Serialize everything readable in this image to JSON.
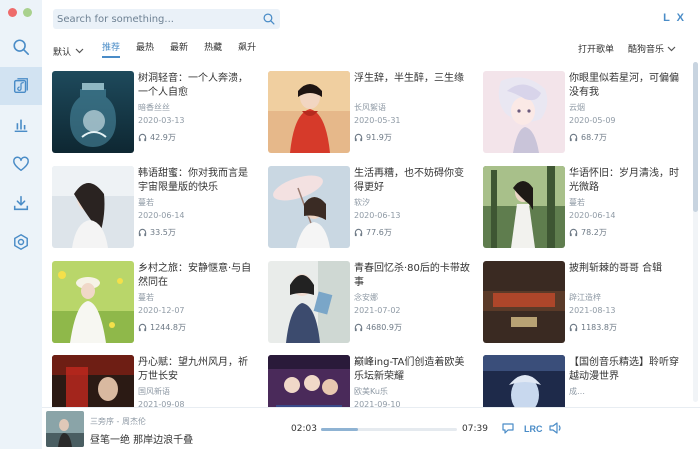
{
  "header": {
    "search_placeholder": "Search for something...",
    "brand": "L X"
  },
  "tabs": {
    "sort_label": "默认",
    "items": [
      "推荐",
      "最热",
      "最新",
      "热藏",
      "飙升"
    ],
    "active_index": 0,
    "open_list": "打开歌单",
    "source": "酷狗音乐"
  },
  "colors": {
    "accent": "#4a8cc7",
    "sidebar_bg": "#ecf3f9",
    "sidebar_active": "#d2e3f2"
  },
  "sidebar": {
    "items": [
      {
        "icon": "search-icon"
      },
      {
        "icon": "music-list-icon",
        "active": true
      },
      {
        "icon": "chart-icon"
      },
      {
        "icon": "heart-icon"
      },
      {
        "icon": "download-icon"
      },
      {
        "icon": "settings-icon"
      }
    ]
  },
  "playlists": [
    {
      "title": "树洞轻音：一个人奔溃，一个人自愈",
      "author": "暗香丝丝",
      "date": "2020-03-13",
      "plays": "42.9万"
    },
    {
      "title": "浮生辞，半生醉，三生缘",
      "author": "长风絮语",
      "date": "2020-05-31",
      "plays": "91.9万"
    },
    {
      "title": "你眼里似若星河，可偏偏没有我",
      "author": "云烟",
      "date": "2020-05-09",
      "plays": "68.7万"
    },
    {
      "title": "韩语甜蜜：你对我而言是宇宙限量版的快乐",
      "author": "蔓若",
      "date": "2020-06-14",
      "plays": "33.5万"
    },
    {
      "title": "生活再糟，也不妨碍你变得更好",
      "author": "软汐",
      "date": "2020-06-13",
      "plays": "77.6万"
    },
    {
      "title": "华语怀旧：岁月清浅，时光微路",
      "author": "蔓若",
      "date": "2020-06-14",
      "plays": "78.2万"
    },
    {
      "title": "乡村之旅：安静惬意·与自然同在",
      "author": "蔓若",
      "date": "2020-12-07",
      "plays": "1244.8万"
    },
    {
      "title": "青春回忆杀·80后的卡带故事",
      "author": "念安娜",
      "date": "2021-07-02",
      "plays": "4680.9万"
    },
    {
      "title": "披荆斩棘的哥哥 合辑",
      "author": "辟江造梓",
      "date": "2021-08-13",
      "plays": "1183.8万"
    },
    {
      "title": "丹心赋：望九州风月，祈万世长安",
      "author": "国风新语",
      "date": "2021-09-08",
      "plays": ""
    },
    {
      "title": "巅峰ing-TA们创造着欧美乐坛新荣耀",
      "author": "欧美Ku乐",
      "date": "2021-09-10",
      "plays": ""
    },
    {
      "title": "【国创音乐精选】聆听穿越动漫世界",
      "author": "成…",
      "date": "",
      "plays": ""
    }
  ],
  "player": {
    "artist": "三旁序 - 周杰伦",
    "song": "昼笔一绝 那岸边浪千叠",
    "current_time": "02:03",
    "total_time": "07:39",
    "progress": 0.27,
    "lrc": "LRC"
  }
}
